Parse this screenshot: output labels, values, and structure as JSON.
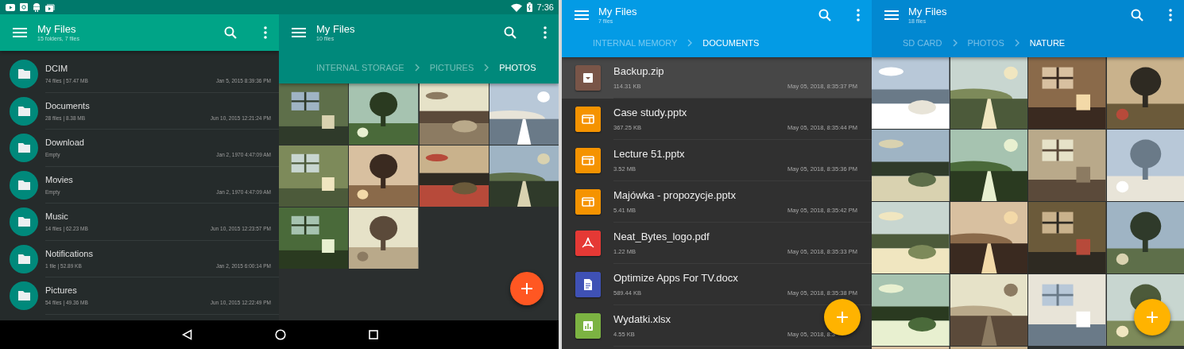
{
  "status_bar": {
    "time": "7:36"
  },
  "screens": [
    {
      "kind": "folders",
      "title": "My Files",
      "subtitle": "15 folders, 7 files",
      "items": [
        {
          "name": "DCIM",
          "info": "74 files | 57.47 MB",
          "date": "Jan 5, 2015 8:39:36 PM"
        },
        {
          "name": "Documents",
          "info": "28 files | 8.38 MB",
          "date": "Jun 10, 2015 12:21:24 PM"
        },
        {
          "name": "Download",
          "info": "Empty",
          "date": "Jan 2, 1970 4:47:09 AM"
        },
        {
          "name": "Movies",
          "info": "Empty",
          "date": "Jan 2, 1970 4:47:09 AM"
        },
        {
          "name": "Music",
          "info": "14 files | 62.23 MB",
          "date": "Jun 10, 2015 12:23:57 PM"
        },
        {
          "name": "Notifications",
          "info": "1 file | 52.89 KB",
          "date": "Jan 2, 2015 6:00:14 PM"
        },
        {
          "name": "Pictures",
          "info": "54 files | 49.36 MB",
          "date": "Jun 10, 2015 12:22:49 PM"
        }
      ]
    },
    {
      "kind": "gallery",
      "title": "My Files",
      "subtitle": "10 files",
      "breadcrumb": [
        {
          "label": "INTERNAL STORAGE",
          "selected": false
        },
        {
          "label": "PICTURES",
          "selected": false
        },
        {
          "label": "PHOTOS",
          "selected": true
        }
      ],
      "photos": [
        {
          "kind": "picture"
        },
        {
          "kind": "picture"
        },
        {
          "kind": "picture"
        },
        {
          "kind": "picture"
        },
        {
          "kind": "picture"
        },
        {
          "kind": "picture"
        },
        {
          "kind": "picture"
        },
        {
          "kind": "picture"
        },
        {
          "kind": "picture"
        },
        {
          "kind": "picture"
        }
      ]
    },
    {
      "kind": "files",
      "title": "My Files",
      "subtitle": "7 files",
      "breadcrumb": [
        {
          "label": "INTERNAL MEMORY",
          "selected": false
        },
        {
          "label": "DOCUMENTS",
          "selected": true
        }
      ],
      "items": [
        {
          "name": "Backup.zip",
          "kind": "archive",
          "size": "114.31 KB",
          "date": "May 05, 2018, 8:35:37 PM",
          "selected": true
        },
        {
          "name": "Case study.pptx",
          "kind": "slides",
          "size": "367.25 KB",
          "date": "May 05, 2018, 8:35:44 PM",
          "selected": false
        },
        {
          "name": "Lecture 51.pptx",
          "kind": "slides",
          "size": "3.52 MB",
          "date": "May 05, 2018, 8:35:36 PM",
          "selected": false
        },
        {
          "name": "Majówka - propozycje.pptx",
          "kind": "slides",
          "size": "5.41 MB",
          "date": "May 05, 2018, 8:35:42 PM",
          "selected": false
        },
        {
          "name": "Neat_Bytes_logo.pdf",
          "kind": "pdf",
          "size": "1.22 MB",
          "date": "May 05, 2018, 8:35:33 PM",
          "selected": false
        },
        {
          "name": "Optimize Apps For TV.docx",
          "kind": "doc",
          "size": "589.44 KB",
          "date": "May 05, 2018, 8:35:38 PM",
          "selected": false
        },
        {
          "name": "Wydatki.xlsx",
          "kind": "sheet",
          "size": "4.55 KB",
          "date": "May 05, 2018, 8:3",
          "selected": false
        }
      ]
    },
    {
      "kind": "gallery",
      "title": "My Files",
      "subtitle": "18 files",
      "breadcrumb": [
        {
          "label": "SD CARD",
          "selected": false
        },
        {
          "label": "PHOTOS",
          "selected": false
        },
        {
          "label": "NATURE",
          "selected": true
        }
      ],
      "photos": [
        {
          "kind": "picture"
        },
        {
          "kind": "picture"
        },
        {
          "kind": "picture"
        },
        {
          "kind": "picture"
        },
        {
          "kind": "picture"
        },
        {
          "kind": "picture"
        },
        {
          "kind": "picture"
        },
        {
          "kind": "picture"
        },
        {
          "kind": "picture"
        },
        {
          "kind": "picture"
        },
        {
          "kind": "picture"
        },
        {
          "kind": "picture"
        },
        {
          "kind": "picture"
        },
        {
          "kind": "picture"
        },
        {
          "kind": "picture"
        },
        {
          "kind": "picture"
        },
        {
          "kind": "picture"
        },
        {
          "kind": "picture"
        }
      ]
    }
  ]
}
